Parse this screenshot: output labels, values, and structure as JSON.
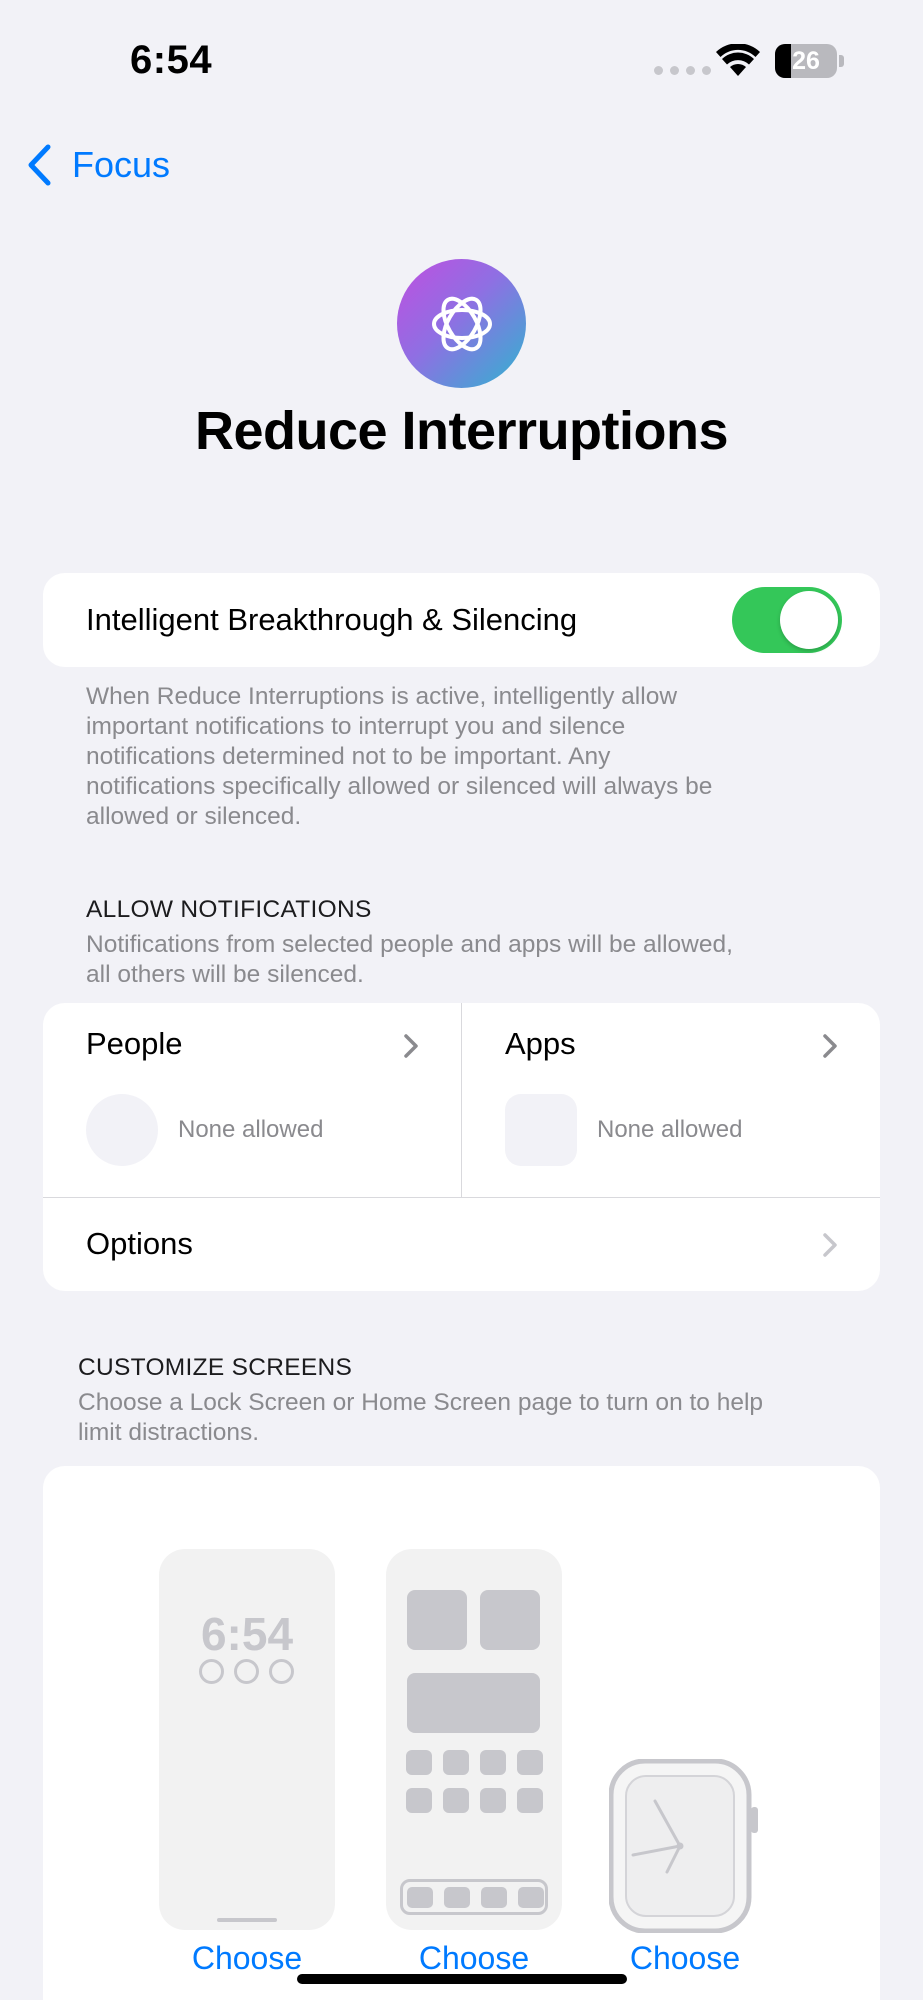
{
  "status_bar": {
    "time": "6:54",
    "battery_level": "26"
  },
  "nav": {
    "back_label": "Focus"
  },
  "header": {
    "title": "Reduce Interruptions",
    "icon": "sparkle-flower-icon",
    "icon_gradient": [
      "#c04fe0",
      "#2fb4cf"
    ]
  },
  "intelligent": {
    "label": "Intelligent Breakthrough & Silencing",
    "enabled": true,
    "footer_lines": [
      "When Reduce Interruptions is active, intelligently allow",
      "important notifications to interrupt you and silence",
      "notifications determined not to be important. Any",
      "notifications specifically allowed or silenced will always be",
      "allowed or silenced."
    ]
  },
  "allow_notifications": {
    "header": "ALLOW NOTIFICATIONS",
    "description_lines": [
      "Notifications from selected people and apps will be allowed,",
      "all others will be silenced."
    ],
    "people": {
      "title": "People",
      "status": "None allowed"
    },
    "apps": {
      "title": "Apps",
      "status": "None allowed"
    },
    "options_label": "Options"
  },
  "customize_screens": {
    "header": "CUSTOMIZE SCREENS",
    "description_lines": [
      "Choose a Lock Screen or Home Screen page to turn on to help",
      "limit distractions."
    ],
    "lock_screen_time": "6:54",
    "choose_labels": [
      "Choose",
      "Choose",
      "Choose"
    ]
  },
  "colors": {
    "accent": "#007aff",
    "toggle_on": "#34c759",
    "background": "#f2f2f7"
  }
}
